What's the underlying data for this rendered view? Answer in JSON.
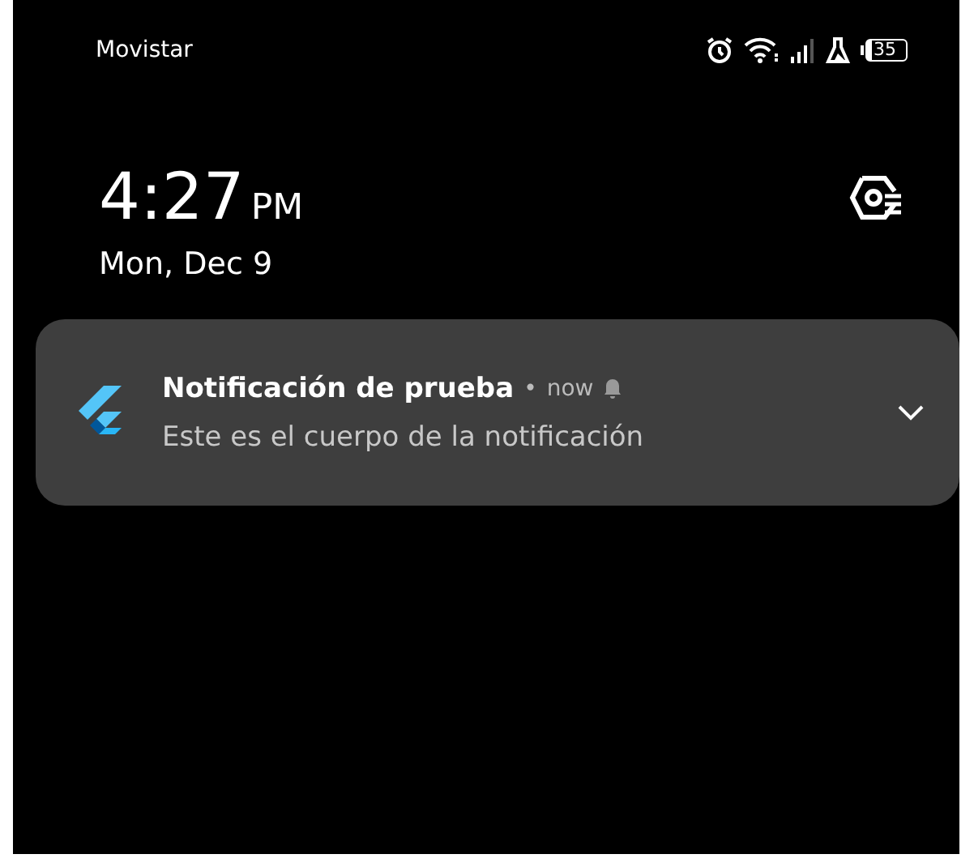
{
  "status_bar": {
    "carrier": "Movistar",
    "battery": "35"
  },
  "clock": {
    "time": "4:27",
    "period": "PM",
    "date": "Mon, Dec 9"
  },
  "notification": {
    "title": "Notificación de prueba",
    "separator": "•",
    "time": "now",
    "body": "Este es el cuerpo de la notificación",
    "expanded": false
  }
}
